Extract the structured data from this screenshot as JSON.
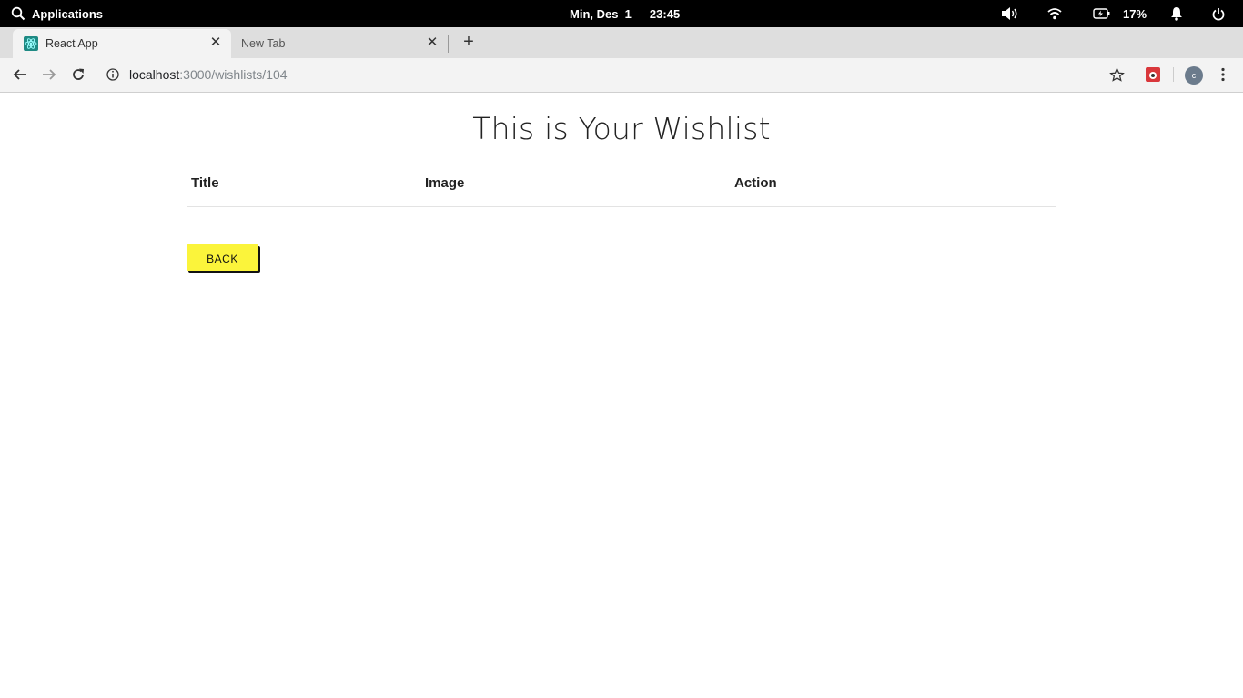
{
  "os_panel": {
    "applications_label": "Applications",
    "date": "Min, Des  1",
    "time": "23:45",
    "battery_percent": "17%"
  },
  "browser": {
    "tabs": [
      {
        "label": "React App",
        "active": true
      },
      {
        "label": "New Tab",
        "active": false
      }
    ],
    "url_host": "localhost",
    "url_path": ":3000/wishlists/104",
    "profile_initial": "c",
    "favicon_color": "#1f8a84",
    "extension_color": "#d9373b"
  },
  "page": {
    "title": "This is Your Wishlist",
    "table": {
      "columns": [
        "Title",
        "Image",
        "Action"
      ],
      "rows": []
    },
    "back_button_label": "BACK",
    "accent_color": "#fbf43b"
  }
}
